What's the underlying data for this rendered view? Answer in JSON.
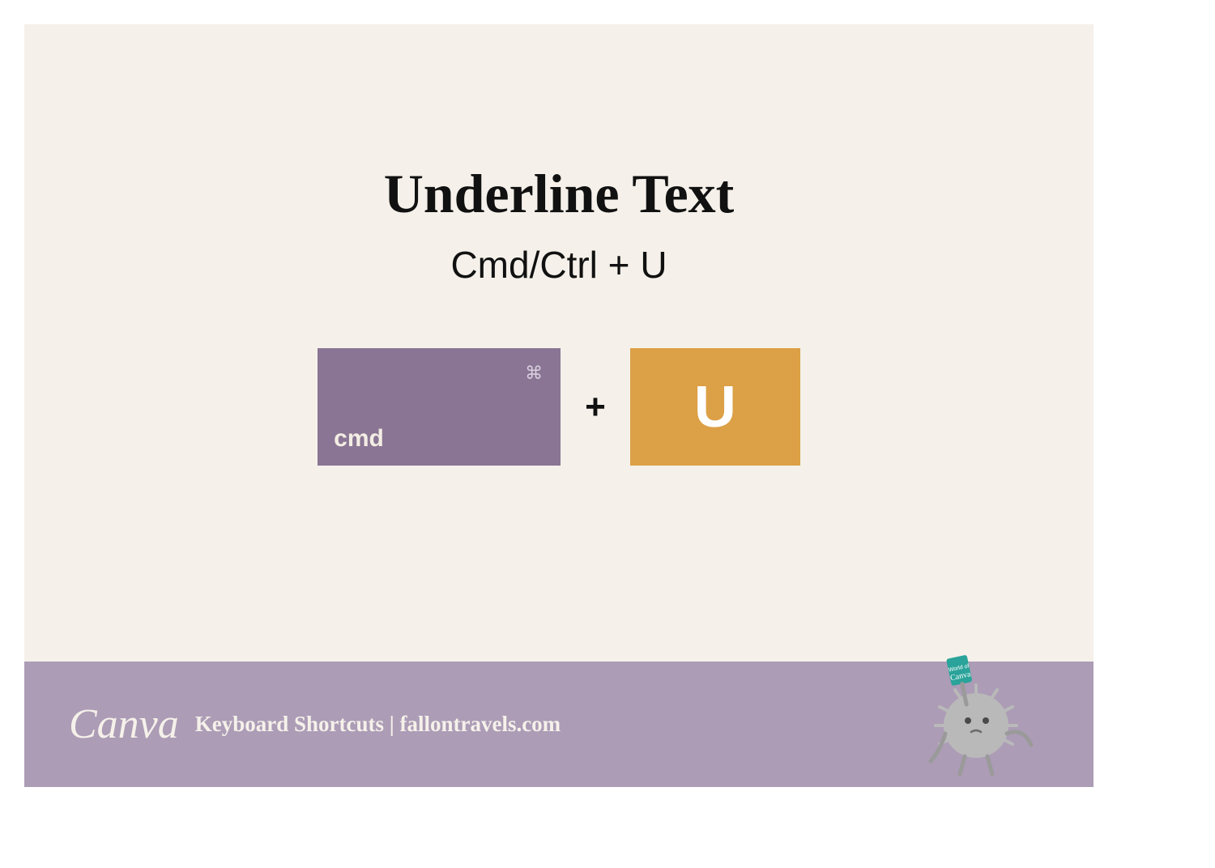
{
  "title": "Underline Text",
  "subtitle": "Cmd/Ctrl + U",
  "keys": {
    "cmd_icon": "⌘",
    "cmd_label": "cmd",
    "plus": "+",
    "u_label": "U"
  },
  "footer": {
    "logo": "Canva",
    "text": "Keyboard Shortcuts | fallontravels.com"
  },
  "colors": {
    "background": "#f5f1ea",
    "cmd_key": "#8a7594",
    "u_key": "#dca046",
    "footer": "#ac9cb6",
    "text_dark": "#111111",
    "text_light": "#f5f1ea"
  }
}
